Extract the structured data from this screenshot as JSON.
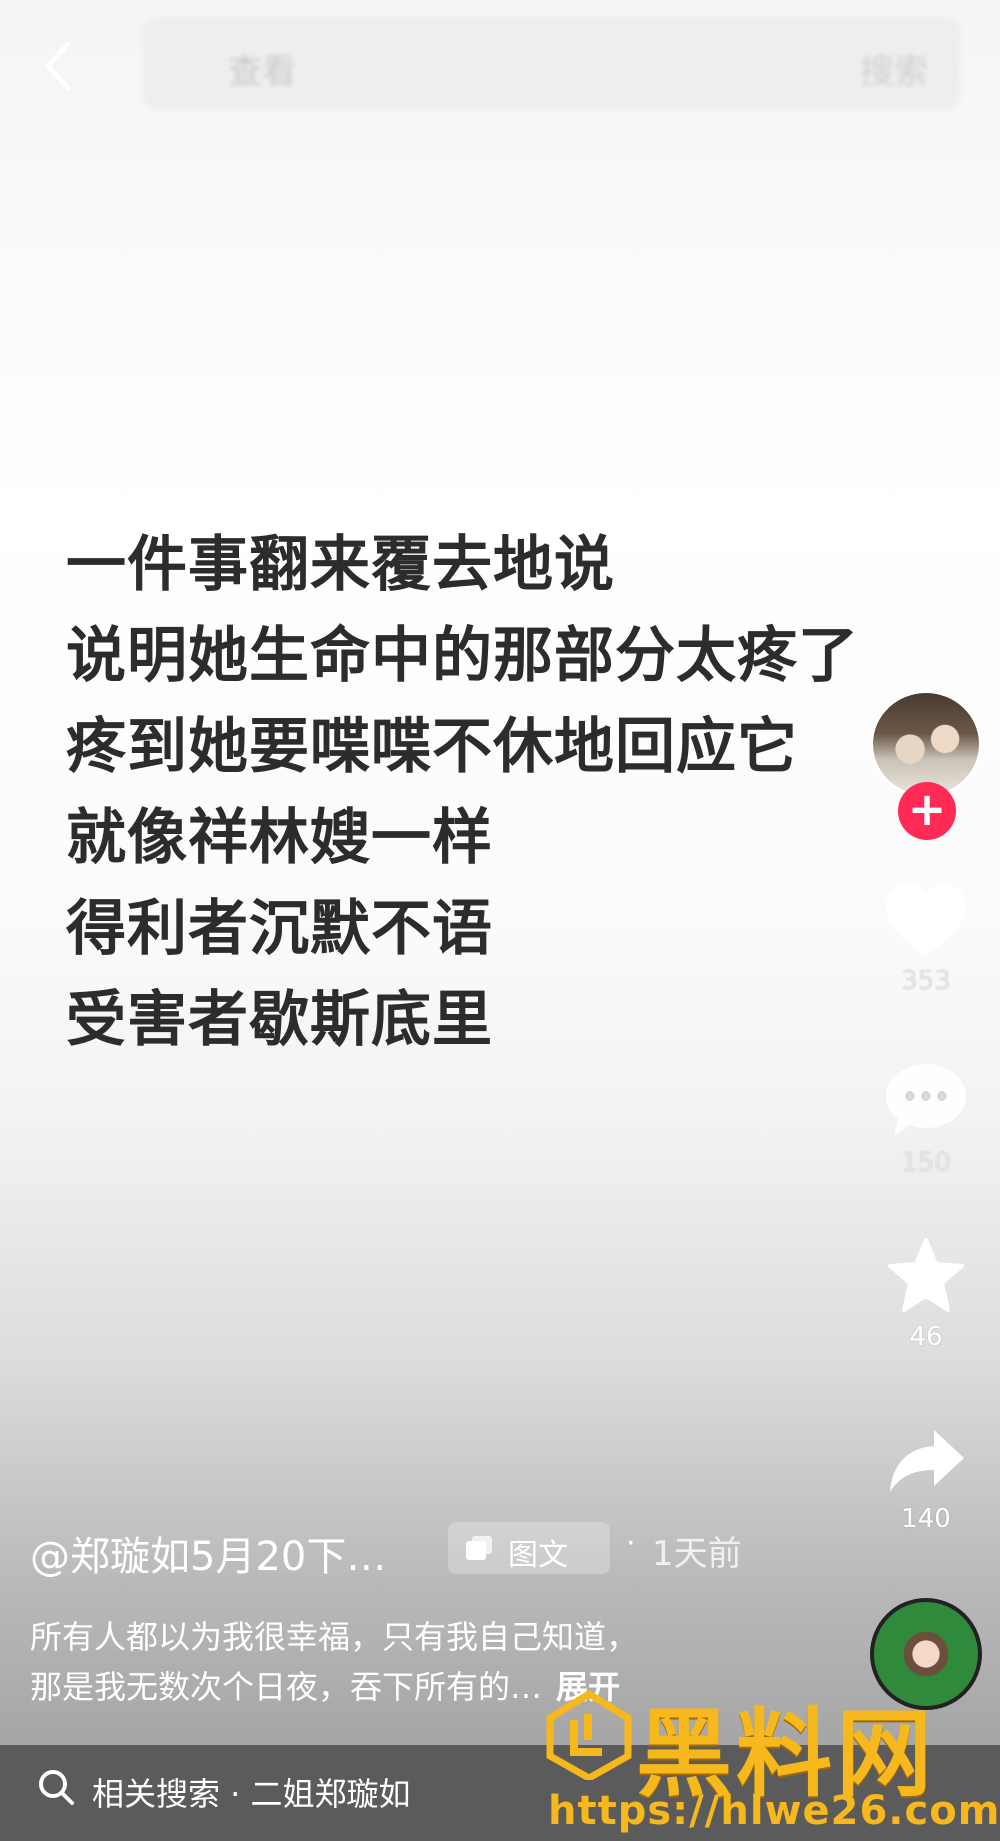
{
  "header": {
    "search_placeholder": "查看",
    "search_button": "搜索"
  },
  "poem": {
    "lines": [
      "一件事翻来覆去地说",
      "说明她生命中的那部分太疼了",
      "疼到她要喋喋不休地回应它",
      "就像祥林嫂一样",
      "得利者沉默不语",
      "受害者歇斯底里"
    ]
  },
  "actions": {
    "likes": "353",
    "comments": "150",
    "favorites": "46",
    "shares": "140"
  },
  "post": {
    "author": "@郑璇如5月20下…",
    "type_tag": "图文",
    "separator": "·",
    "time": "1天前",
    "desc_line1": "所有人都以为我很幸福，只有我自己知道，",
    "desc_line2": "那是我无数次个日夜，吞下所有的…",
    "more": "展开"
  },
  "bottom": {
    "related_search": "相关搜索 · 二姐郑璇如"
  },
  "watermark": {
    "title": "黑料网",
    "url": "https://hlwe26.com"
  },
  "colors": {
    "follow": "#ff2a55",
    "watermark": "#f6b81c"
  }
}
